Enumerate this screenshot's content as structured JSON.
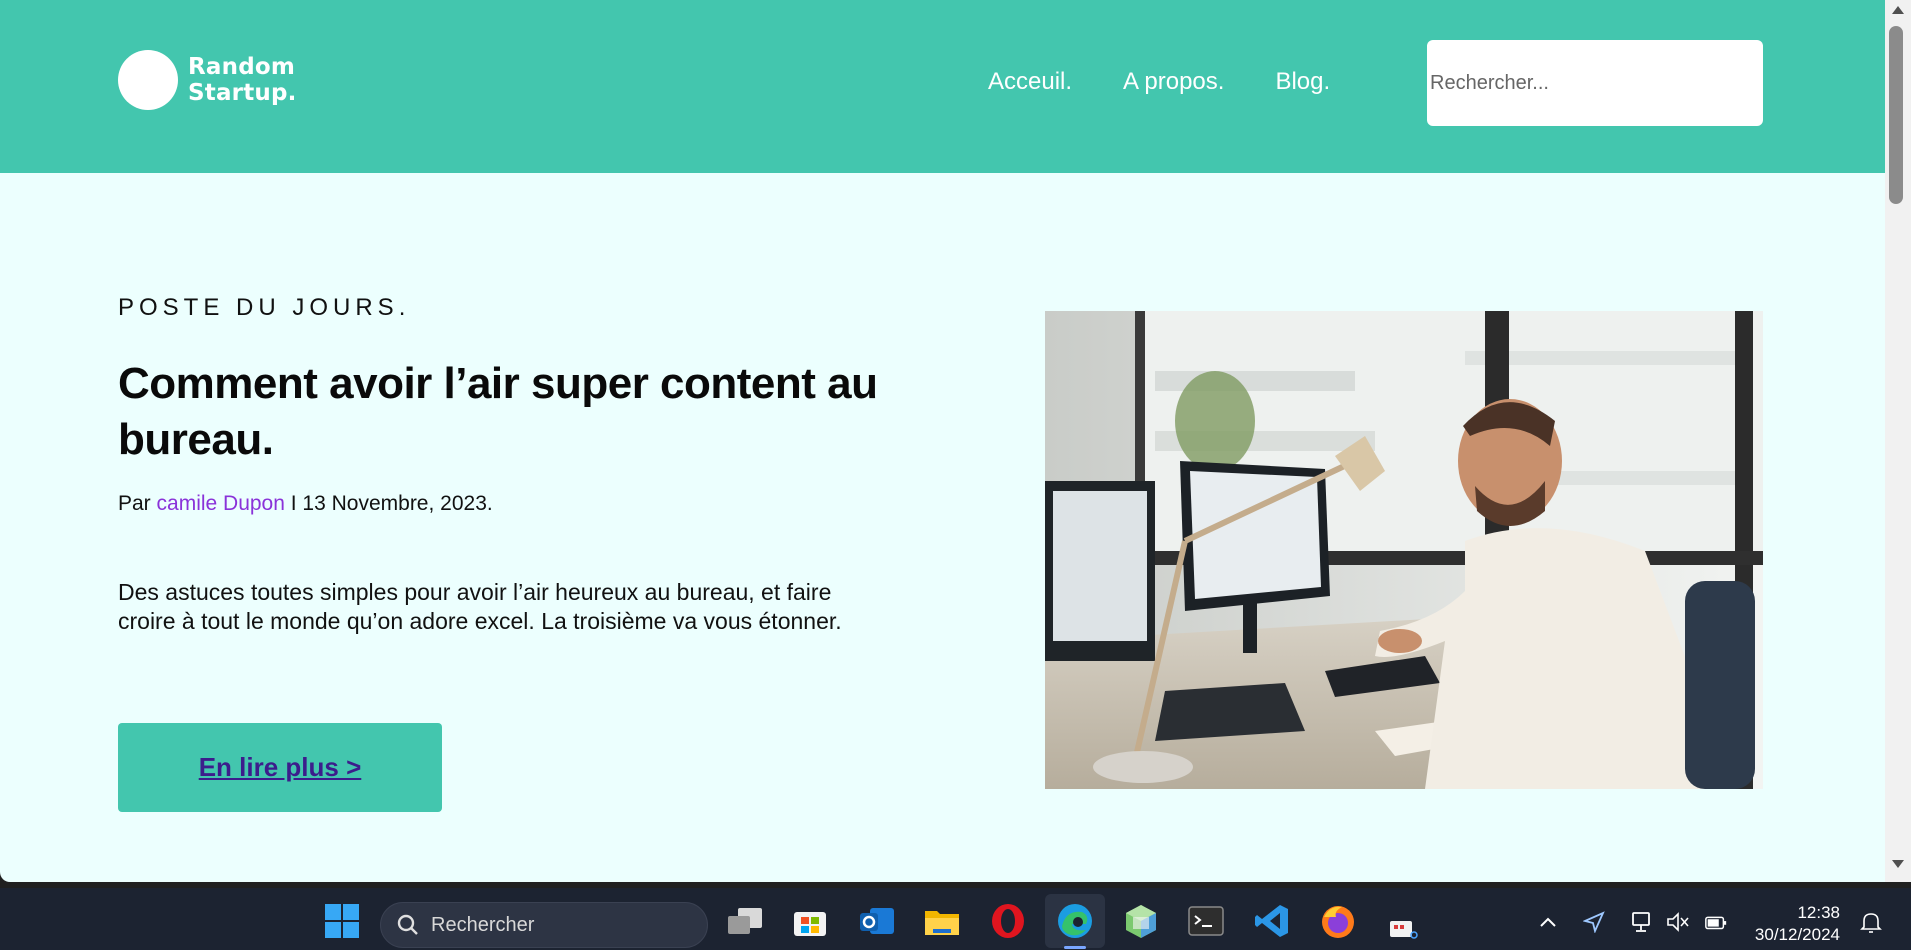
{
  "site": {
    "logo_line1": "Random",
    "logo_line2": "Startup.",
    "nav": [
      "Acceuil.",
      "A propos.",
      "Blog."
    ],
    "search_placeholder": "Rechercher..."
  },
  "post": {
    "kicker": "POSTE DU JOURS.",
    "title": "Comment avoir l’air super content au bureau.",
    "by_prefix": "Par ",
    "author": "camile Dupon",
    "by_suffix": " I 13 Novembre, 2023.",
    "excerpt": "Des astuces toutes simples pour avoir l’air heureux au bureau, et faire croire à tout le monde qu’on adore excel. La troisième va vous étonner.",
    "cta": "En lire plus >"
  },
  "taskbar": {
    "search_label": "Rechercher",
    "time": "12:38",
    "date": "30/12/2024",
    "apps": [
      "windows-start-icon",
      "task-view-icon",
      "microsoft-store-icon",
      "outlook-icon",
      "file-explorer-icon",
      "opera-icon",
      "edge-icon",
      "3d-box-app-icon",
      "terminal-icon",
      "vscode-icon",
      "firefox-icon",
      "snipping-tool-icon"
    ],
    "tray": [
      "chevron-up-icon",
      "location-icon",
      "network-icon",
      "volume-muted-icon",
      "battery-icon",
      "notification-bell-icon"
    ]
  },
  "colors": {
    "header_bg": "#43c6ae",
    "page_bg": "#ecfffe",
    "author_link": "#8a33d9",
    "cta_text": "#3c1d8c",
    "taskbar_bg": "#1c2331"
  }
}
